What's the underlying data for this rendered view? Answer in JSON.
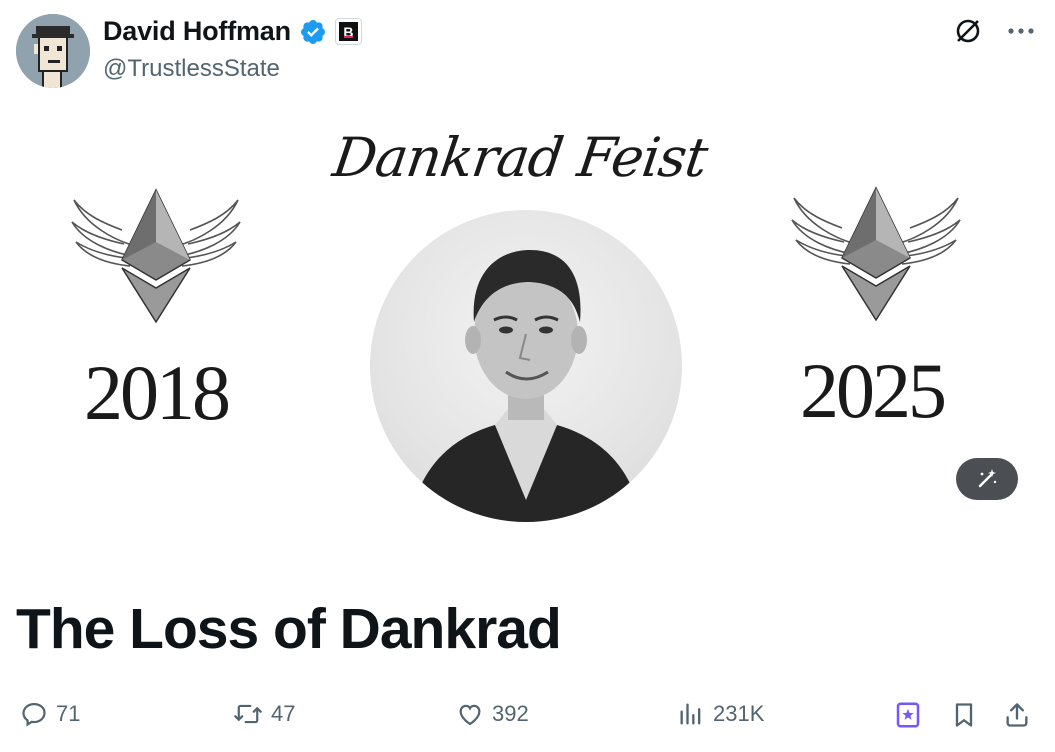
{
  "author": {
    "display_name": "David Hoffman",
    "handle": "@TrustlessState",
    "verified": true,
    "affiliation_badge": "B"
  },
  "icons": {
    "verified": "verified-badge-icon",
    "grok": "grok-icon",
    "more": "more-icon",
    "magic": "magic-wand-icon",
    "reply": "reply-icon",
    "repost": "repost-icon",
    "like": "heart-icon",
    "views": "views-icon",
    "grok_action": "grok-bookmark-icon",
    "bookmark": "bookmark-icon",
    "share": "share-icon"
  },
  "media": {
    "script_title": "Dankrad Feist",
    "year_left": "2018",
    "year_right": "2025"
  },
  "post": {
    "title": "The Loss of Dankrad"
  },
  "stats": {
    "replies": "71",
    "reposts": "47",
    "likes": "392",
    "views": "231K"
  },
  "colors": {
    "accent": "#1d9bf0",
    "muted": "#536471",
    "text": "#0f1419",
    "grok_purple": "#7856ff"
  }
}
